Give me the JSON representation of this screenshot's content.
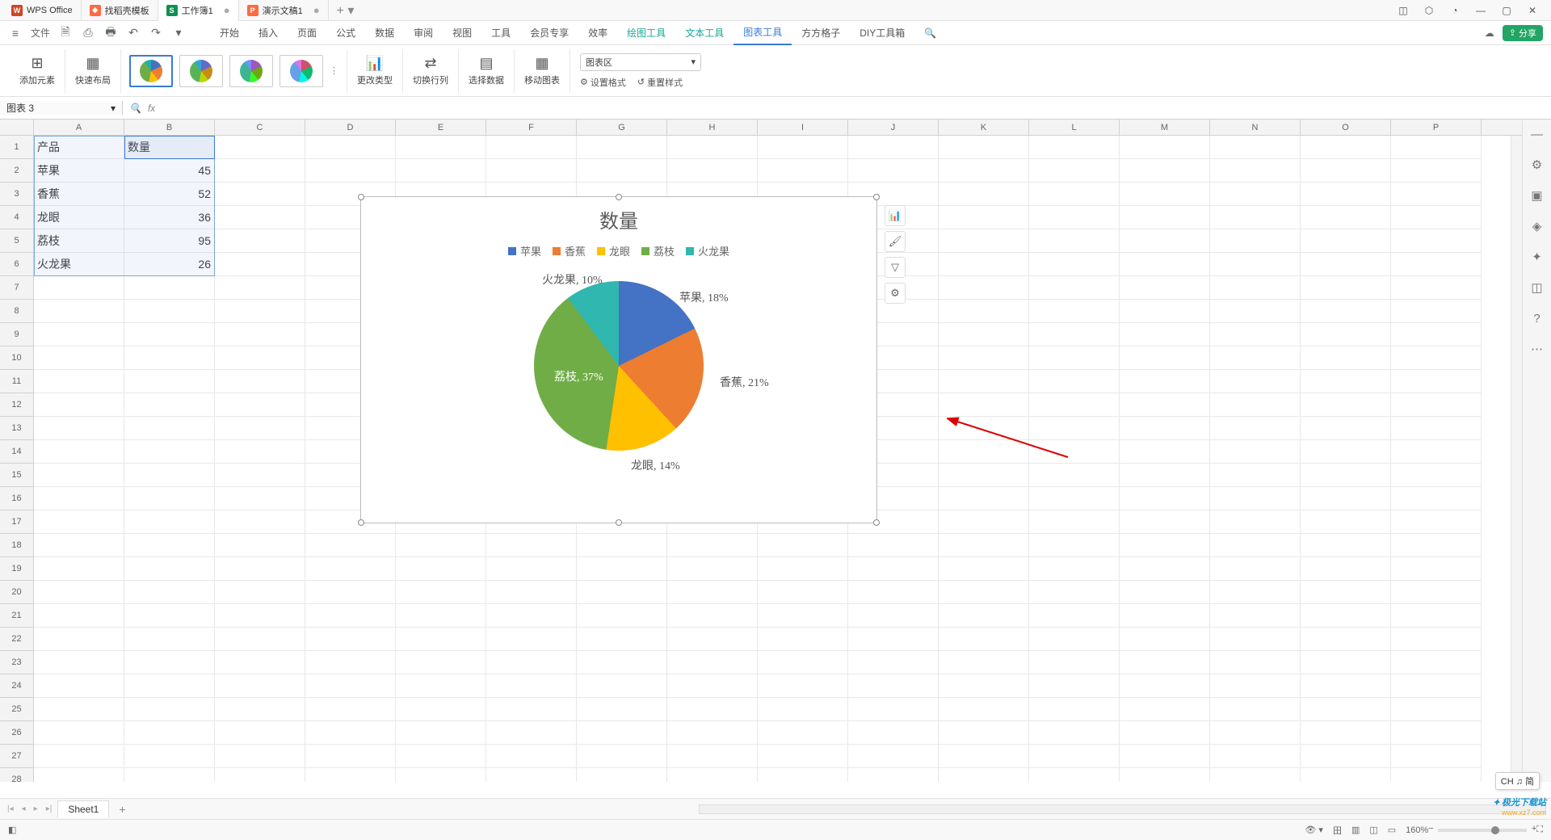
{
  "title_tabs": [
    {
      "icon": "W",
      "cls": "red",
      "label": "WPS Office"
    },
    {
      "icon": "",
      "cls": "orange",
      "label": "找稻壳模板"
    },
    {
      "icon": "S",
      "cls": "green",
      "label": "工作簿1",
      "active": true,
      "closable": true
    },
    {
      "icon": "P",
      "cls": "orange2",
      "label": "演示文稿1",
      "closable": true
    }
  ],
  "share_btn": "分享",
  "file_menu": "文件",
  "main_menu": [
    "开始",
    "插入",
    "页面",
    "公式",
    "数据",
    "审阅",
    "视图",
    "工具",
    "会员专享",
    "效率"
  ],
  "teal_menu": [
    "绘图工具",
    "文本工具"
  ],
  "active_menu": "图表工具",
  "extra_menu": [
    "方方格子",
    "DIY工具箱"
  ],
  "ribbon": {
    "add_elem": "添加元素",
    "quick_layout": "快速布局",
    "change_type": "更改类型",
    "swap_rc": "切换行列",
    "select_data": "选择数据",
    "move_chart": "移动图表",
    "area_select": "图表区",
    "set_fmt": "设置格式",
    "reset_style": "重置样式"
  },
  "name_box": "图表 3",
  "columns": [
    "A",
    "B",
    "C",
    "D",
    "E",
    "F",
    "G",
    "H",
    "I",
    "J",
    "K",
    "L",
    "M",
    "N",
    "O",
    "P"
  ],
  "rows": 28,
  "table": {
    "headers": [
      "产品",
      "数量"
    ],
    "data": [
      [
        "苹果",
        "45"
      ],
      [
        "香蕉",
        "52"
      ],
      [
        "龙眼",
        "36"
      ],
      [
        "荔枝",
        "95"
      ],
      [
        "火龙果",
        "26"
      ]
    ]
  },
  "chart_data": {
    "type": "pie",
    "title": "数量",
    "series_name": "数量",
    "categories": [
      "苹果",
      "香蕉",
      "龙眼",
      "荔枝",
      "火龙果"
    ],
    "values": [
      45,
      52,
      36,
      95,
      26
    ],
    "percent_labels": [
      "苹果, 18%",
      "香蕉, 21%",
      "龙眼, 14%",
      "荔枝, 37%",
      "火龙果, 10%"
    ],
    "colors": [
      "#4472C4",
      "#ED7D31",
      "#FFC000",
      "#70AD47",
      "#2FB7B0"
    ]
  },
  "sheet_tab": "Sheet1",
  "zoom": "160%",
  "ime": "CH ♫ 简",
  "watermark": {
    "l1": "极光下载站",
    "l2": "www.xz7.com"
  },
  "status_icon": "◧"
}
